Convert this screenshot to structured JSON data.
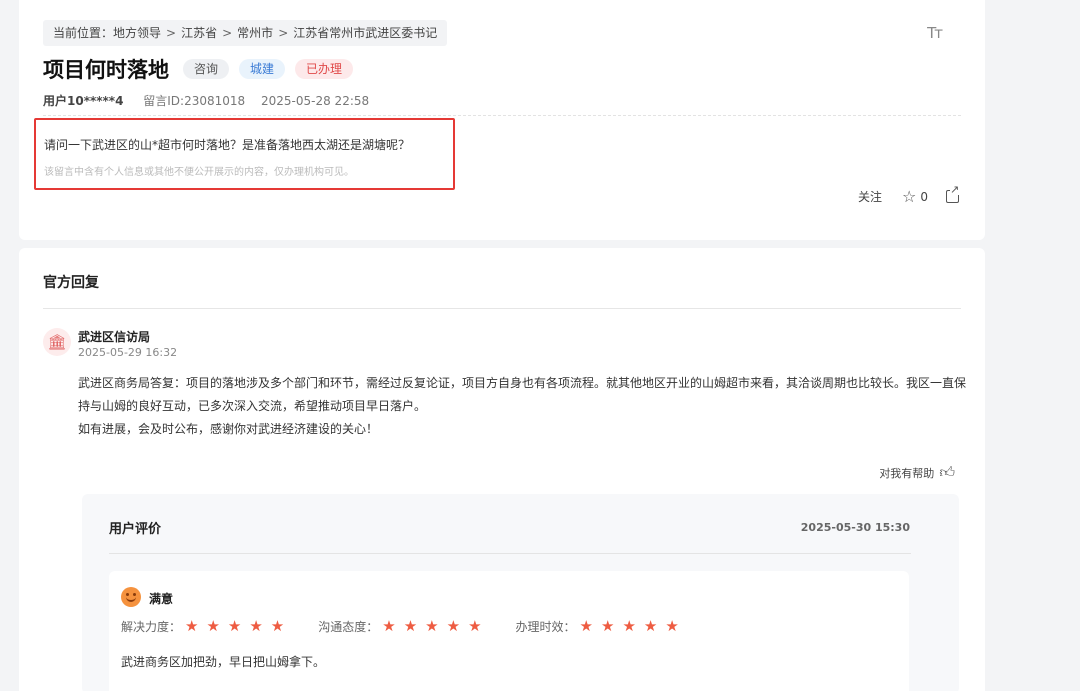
{
  "breadcrumb": {
    "prefix": "当前位置：",
    "items": [
      "地方领导",
      "江苏省",
      "常州市",
      "江苏省常州市武进区委书记"
    ],
    "separator": ">"
  },
  "font_size_icon": "Tт",
  "question": {
    "title": "项目何时落地",
    "tags": [
      "咨询",
      "城建",
      "已办理"
    ],
    "user": "用户10*****4",
    "message_id": "留言ID:23081018",
    "datetime": "2025-05-28 22:58",
    "text": "请问一下武进区的山*超市何时落地？是准备落地西太湖还是湖塘呢？",
    "privacy_note": "该留言中含有个人信息或其他不便公开展示的内容，仅办理机构可见。"
  },
  "actions": {
    "follow": "关注",
    "star_count": "0"
  },
  "reply_section": {
    "title": "官方回复",
    "org_name": "武进区信访局",
    "org_time": "2025-05-29 16:32",
    "paragraph1": "武进区商务局答复：项目的落地涉及多个部门和环节，需经过反复论证，项目方自身也有各项流程。就其他地区开业的山姆超市来看，其洽谈周期也比较长。我区一直保持与山姆的良好互动，已多次深入交流，希望推动项目早日落户。",
    "paragraph2": "如有进展，会及时公布，感谢你对武进经济建设的关心！",
    "helpful": "对我有帮助"
  },
  "evaluation": {
    "title": "用户评价",
    "datetime": "2025-05-30 15:30",
    "result": "满意",
    "ratings": [
      {
        "label": "解决力度：",
        "stars": 5
      },
      {
        "label": "沟通态度：",
        "stars": 5
      },
      {
        "label": "办理时效：",
        "stars": 5
      }
    ],
    "comment": "武进商务区加把劲，早日把山姆拿下。"
  },
  "colors": {
    "highlight_border": "#e53935",
    "star": "#ee5c42",
    "tag_done": "#e04a4a",
    "tag_build": "#3a7bd5"
  }
}
